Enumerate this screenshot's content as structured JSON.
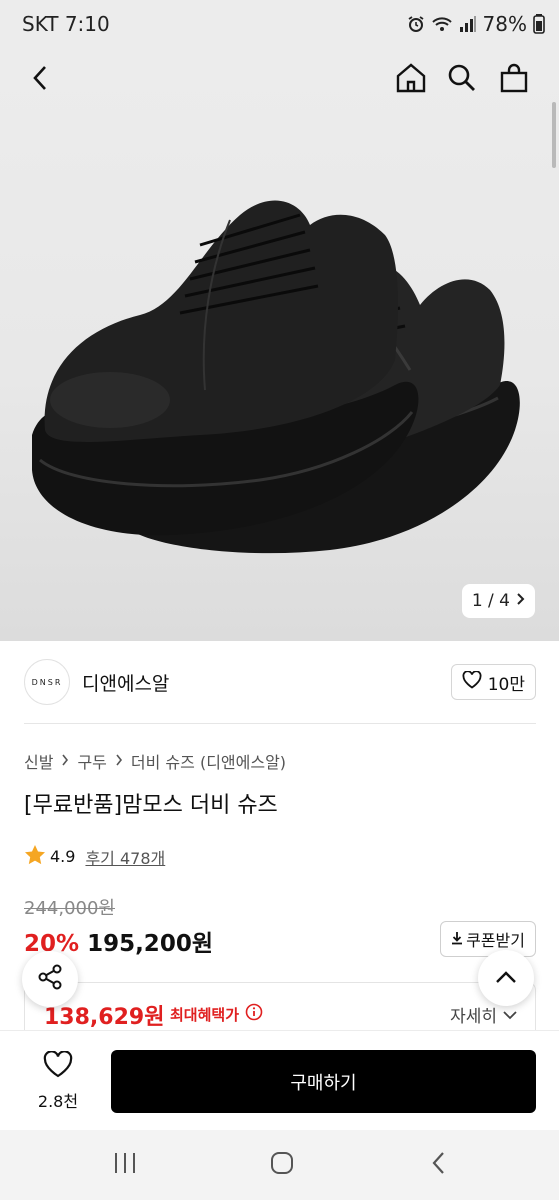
{
  "status_bar": {
    "carrier_time": "SKT 7:10",
    "battery": "78%"
  },
  "nav": {
    "back_icon": "chevron-left-icon",
    "home_icon": "home-icon",
    "search_icon": "search-icon",
    "cart_icon": "shopping-bag-icon"
  },
  "gallery": {
    "counter": "1 / 4"
  },
  "brand": {
    "logo_text": "DNSR",
    "name": "디앤에스알",
    "likes": "10만"
  },
  "breadcrumb": [
    "신발",
    "구두",
    "더비 슈즈 (디앤에스알)"
  ],
  "product": {
    "title": "[무료반품]맘모스 더비 슈즈",
    "rating": "4.9",
    "reviews": "후기 478개",
    "original_price": "244,000원",
    "discount": "20%",
    "sale_price": "195,200원",
    "coupon_label": "쿠폰받기",
    "max_benefit_price": "138,629원",
    "max_benefit_label": "최대혜택가",
    "detail_label": "자세히"
  },
  "bottom_bar": {
    "wishlist_count": "2.8천",
    "buy_label": "구매하기"
  },
  "colors": {
    "accent_red": "#e02020",
    "buy_button": "#000000",
    "star": "#f5a623"
  }
}
